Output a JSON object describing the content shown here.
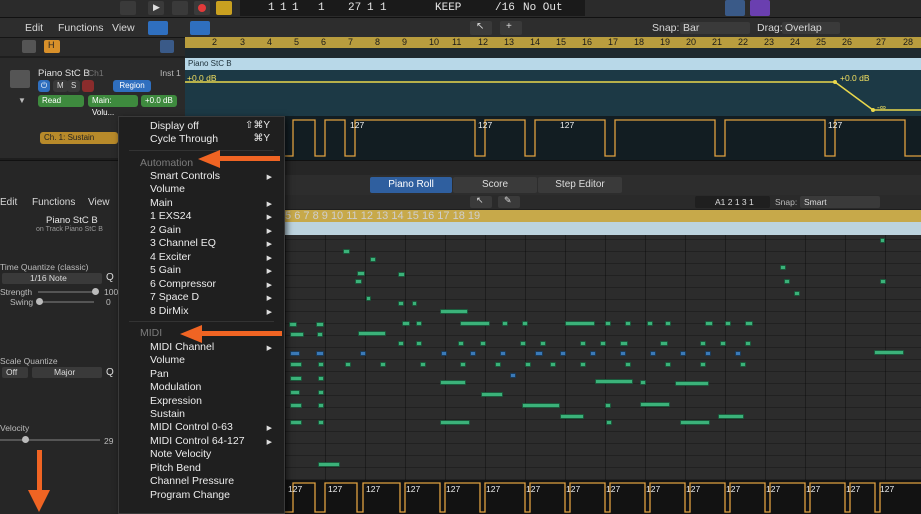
{
  "transport": {
    "bar": "1",
    "beat": "1",
    "div": "1",
    "tick": "1",
    "end_bar": "27",
    "end_beat": "1",
    "end_div": "1",
    "keep": "KEEP",
    "division": "/16",
    "midi_out": "No Out"
  },
  "menubar": {
    "edit": "Edit",
    "functions": "Functions",
    "view": "View",
    "snap_label": "Snap:",
    "snap_value": "Bar",
    "drag_label": "Drag:",
    "drag_value": "Overlap"
  },
  "ruler": {
    "ticks": [
      "2",
      "3",
      "4",
      "5",
      "6",
      "7",
      "8",
      "9",
      "10",
      "11",
      "12",
      "13",
      "14",
      "15",
      "16",
      "17",
      "18",
      "19",
      "20",
      "21",
      "22",
      "23",
      "24",
      "25",
      "26",
      "27",
      "28"
    ]
  },
  "track": {
    "name": "Piano StC B",
    "channel": "Ch1",
    "inst": "Inst 1",
    "region_btn": "Region",
    "read": "Read",
    "main_vol": "Main: Volu...",
    "gain": "+0.0 dB",
    "sustain": "Ch. 1: Sustain",
    "region_name": "Piano StC B",
    "auto_label_left": "+0.0 dB",
    "auto_label_right": "+0.0 dB",
    "auto_label_end": "-∞",
    "m": "M",
    "s": "S"
  },
  "piano_roll": {
    "tabs": [
      "Piano Roll",
      "Score",
      "Step Editor"
    ],
    "edit": "Edit",
    "functions": "Functions",
    "view": "View",
    "region_name": "Piano StC B",
    "region_sub": "on Track Piano StC B",
    "position": "A1  2 1 3 1",
    "snap_label": "Snap:",
    "snap_value": "Smart",
    "ruler": [
      "5",
      "6",
      "7",
      "8",
      "9",
      "10",
      "11",
      "12",
      "13",
      "14",
      "15",
      "16",
      "17",
      "18",
      "19"
    ],
    "time_quantize_label": "Time Quantize (classic)",
    "time_quantize_value": "1/16 Note",
    "q": "Q",
    "strength_label": "Strength",
    "strength_value": "100",
    "swing_label": "Swing",
    "swing_value": "0",
    "scale_quantize_label": "Scale Quantize",
    "scale_off": "Off",
    "scale_major": "Major",
    "velocity_label": "Velocity",
    "velocity_value": "29",
    "vel_tag": "127"
  },
  "context_menu": {
    "display_off": "Display off",
    "display_off_sc": "⇧⌘Y",
    "cycle_through": "Cycle Through",
    "cycle_through_sc": "⌘Y",
    "automation_header": "Automation",
    "automation_items": [
      "Smart Controls",
      "Volume",
      "Main",
      "1 EXS24",
      "2 Gain",
      "3 Channel EQ",
      "4 Exciter",
      "5 Gain",
      "6 Compressor",
      "7 Space D",
      "8 DirMix"
    ],
    "midi_header": "MIDI",
    "midi_items": [
      "MIDI Channel",
      "Volume",
      "Pan",
      "Modulation",
      "Expression",
      "Sustain",
      "MIDI Control 0-63",
      "MIDI Control 64-127",
      "Note Velocity",
      "Pitch Bend",
      "Channel Pressure",
      "Program Change"
    ]
  },
  "colors": {
    "accent_orange": "#f06423",
    "note_green": "#3bb27a",
    "note_blue": "#3b7ab8",
    "ruler_gold": "#b99d3e"
  }
}
